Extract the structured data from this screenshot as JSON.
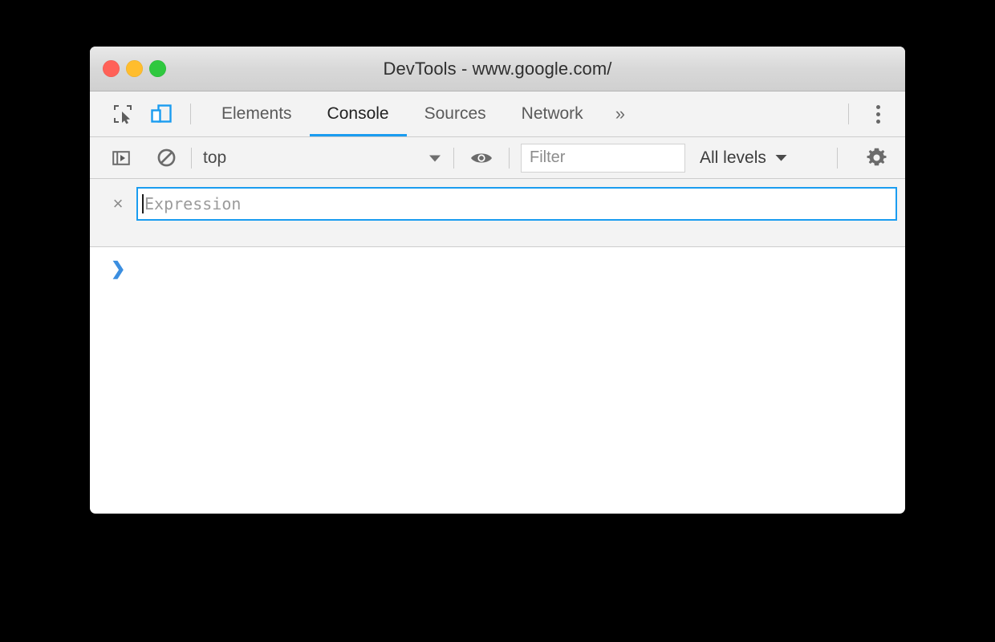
{
  "window": {
    "title": "DevTools - www.google.com/",
    "traffic_lights": [
      {
        "name": "close",
        "color": "#ff6158"
      },
      {
        "name": "minimize",
        "color": "#ffbd2d"
      },
      {
        "name": "maximize",
        "color": "#2fc83f"
      }
    ]
  },
  "tabbar": {
    "inspect_icon": "inspect-element-icon",
    "device_icon": "device-toolbar-icon",
    "tabs": [
      {
        "label": "Elements",
        "active": false
      },
      {
        "label": "Console",
        "active": true
      },
      {
        "label": "Sources",
        "active": false
      },
      {
        "label": "Network",
        "active": false
      }
    ],
    "more_tabs_label": "»",
    "kebab_icon": "more-options-icon",
    "accent_color": "#1a9cf0",
    "active_device_icon_color": "#1a9cf0"
  },
  "console_toolbar": {
    "sidebar_toggle_icon": "console-sidebar-icon",
    "clear_console_icon": "clear-console-icon",
    "context": {
      "value": "top",
      "arrow": "▼"
    },
    "eye_icon": "live-expression-eye-icon",
    "filter": {
      "value": "",
      "placeholder": "Filter"
    },
    "levels": {
      "value": "All levels",
      "arrow": "▼"
    },
    "settings_icon": "gear-icon"
  },
  "live_expression": {
    "remove_label": "×",
    "input_value": "",
    "input_placeholder": "Expression",
    "focused": true,
    "border_color": "#1a9cf0"
  },
  "console_body": {
    "prompt_symbol": "❯",
    "prompt_color": "#3b8ee0",
    "messages": []
  }
}
